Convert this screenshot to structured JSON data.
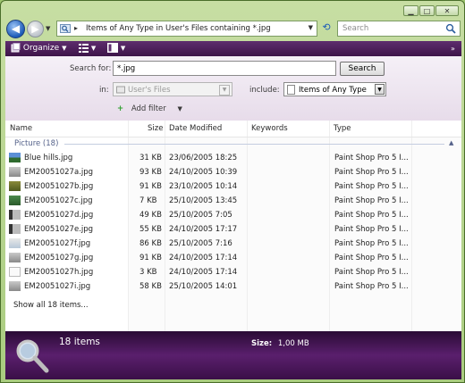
{
  "address": {
    "text": "Items of Any Type in User's Files containing *.jpg"
  },
  "search_box": {
    "placeholder": "Search"
  },
  "toolbar": {
    "organize": "Organize"
  },
  "search_pane": {
    "search_for_label": "Search for:",
    "search_for_value": "*.jpg",
    "search_button": "Search",
    "in_label": "in:",
    "in_value": "User's Files",
    "include_label": "include:",
    "include_value": "Items of Any Type",
    "add_filter": "Add filter"
  },
  "columns": {
    "name": "Name",
    "size": "Size",
    "date": "Date Modified",
    "keywords": "Keywords",
    "type": "Type"
  },
  "group": {
    "label": "Picture (18)"
  },
  "files": [
    {
      "name": "Blue hills.jpg",
      "size": "31 KB",
      "date": "23/06/2005 18:25",
      "type": "Paint Shop Pro 5 I...",
      "thumb": "blue"
    },
    {
      "name": "EM20051027a.jpg",
      "size": "93 KB",
      "date": "24/10/2005 10:39",
      "type": "Paint Shop Pro 5 I...",
      "thumb": "grey"
    },
    {
      "name": "EM20051027b.jpg",
      "size": "91 KB",
      "date": "23/10/2005 10:14",
      "type": "Paint Shop Pro 5 I...",
      "thumb": "olive"
    },
    {
      "name": "EM20051027c.jpg",
      "size": "7 KB",
      "date": "25/10/2005 13:45",
      "type": "Paint Shop Pro 5 I...",
      "thumb": "green"
    },
    {
      "name": "EM20051027d.jpg",
      "size": "49 KB",
      "date": "25/10/2005 7:05",
      "type": "Paint Shop Pro 5 I...",
      "thumb": "dark"
    },
    {
      "name": "EM20051027e.jpg",
      "size": "55 KB",
      "date": "24/10/2005 17:17",
      "type": "Paint Shop Pro 5 I...",
      "thumb": "dark"
    },
    {
      "name": "EM20051027f.jpg",
      "size": "86 KB",
      "date": "25/10/2005 7:16",
      "type": "Paint Shop Pro 5 I...",
      "thumb": "light"
    },
    {
      "name": "EM20051027g.jpg",
      "size": "91 KB",
      "date": "24/10/2005 17:14",
      "type": "Paint Shop Pro 5 I...",
      "thumb": "grey"
    },
    {
      "name": "EM20051027h.jpg",
      "size": "3 KB",
      "date": "24/10/2005 17:14",
      "type": "Paint Shop Pro 5 I...",
      "thumb": "white"
    },
    {
      "name": "EM20051027i.jpg",
      "size": "58 KB",
      "date": "25/10/2005 14:01",
      "type": "Paint Shop Pro 5 I...",
      "thumb": "grey"
    }
  ],
  "show_all": "Show all 18 items...",
  "details": {
    "count": "18 items",
    "size_label": "Size:",
    "size_value": "1,00 MB"
  },
  "colors": {
    "accent": "#4a1a5c",
    "details_bg": "#3a0f47",
    "frame": "#a9cc7f"
  }
}
